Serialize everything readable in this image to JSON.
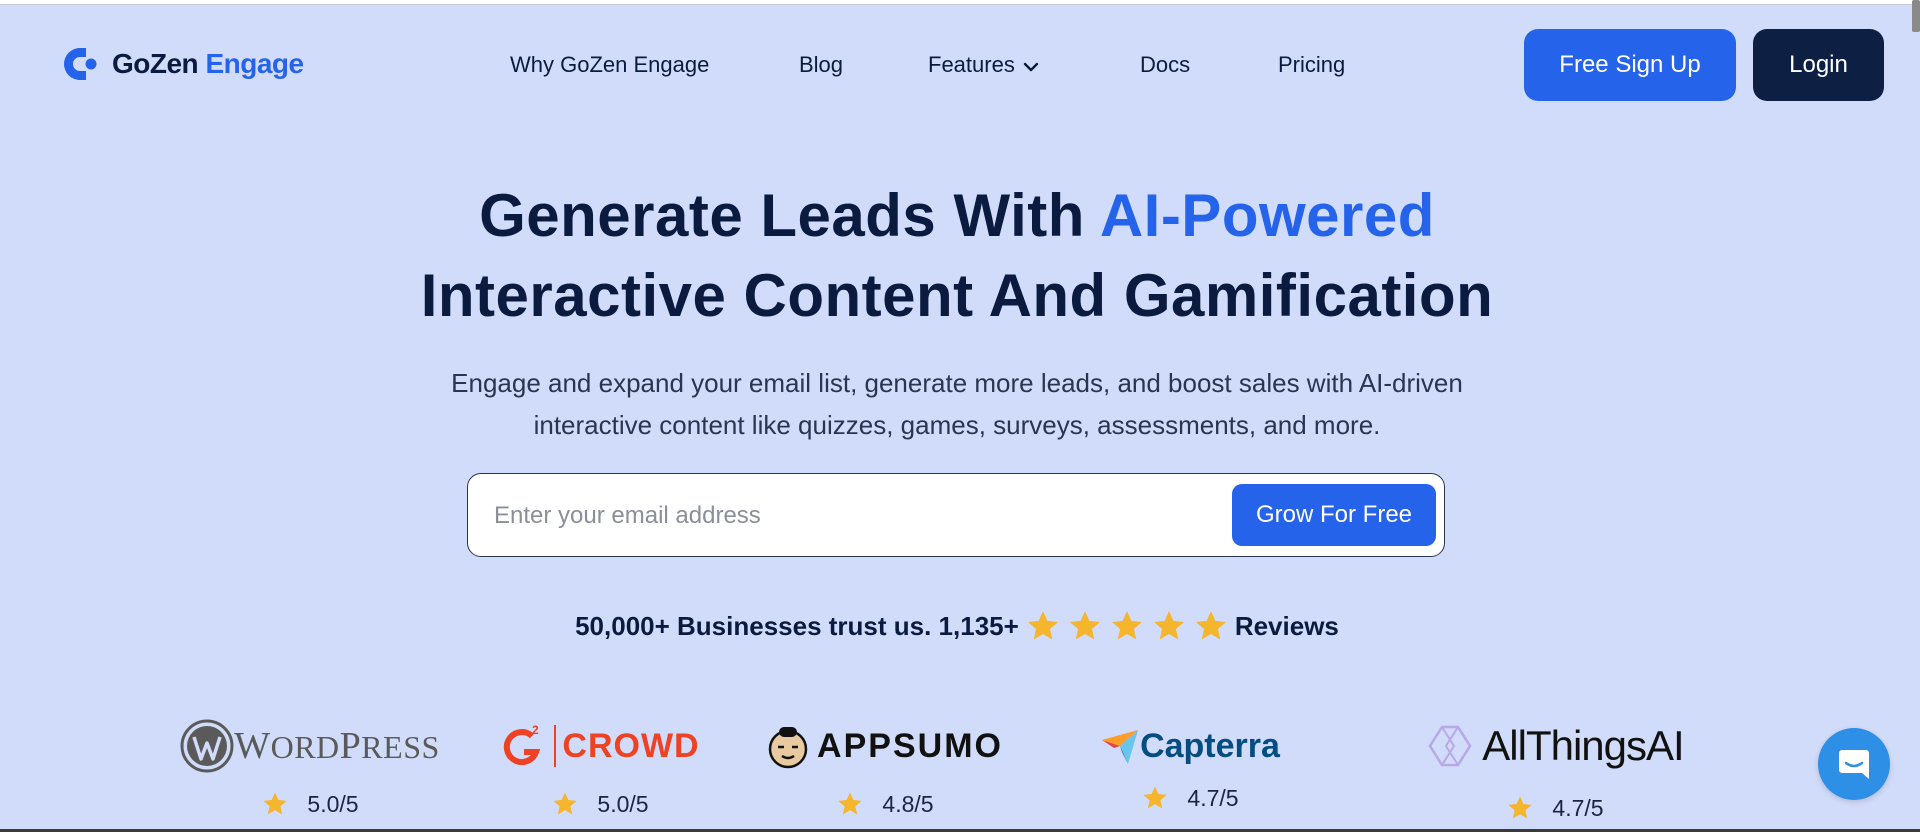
{
  "brand": {
    "name_part1": "GoZen",
    "name_part2": "Engage"
  },
  "nav": {
    "items": [
      {
        "label": "Why GoZen Engage"
      },
      {
        "label": "Blog"
      },
      {
        "label": "Features"
      },
      {
        "label": "Docs"
      },
      {
        "label": "Pricing"
      }
    ]
  },
  "header": {
    "signup_label": "Free Sign Up",
    "login_label": "Login"
  },
  "hero": {
    "title_line1_plain": "Generate Leads With ",
    "title_line1_accent": "AI-Powered",
    "title_line2": "Interactive Content And Gamification",
    "subtitle_line1": "Engage and expand your email list, generate more leads, and boost sales with AI-driven",
    "subtitle_line2": "interactive content like quizzes, games, surveys, assessments, and more."
  },
  "signup_form": {
    "email_placeholder": "Enter your email address",
    "email_value": "",
    "submit_label": "Grow For Free"
  },
  "trust": {
    "text_before": "50,000+ Businesses trust us. 1,135+",
    "star_count": 5,
    "text_after": "Reviews"
  },
  "reviews": [
    {
      "platform": "WordPress",
      "logo_text_a": "W",
      "logo_text_b": "ORD",
      "logo_text_c": "P",
      "logo_text_d": "RESS",
      "rating": "5.0/5"
    },
    {
      "platform": "G2 Crowd",
      "logo_text": "CROWD",
      "rating": "5.0/5"
    },
    {
      "platform": "AppSumo",
      "logo_text": "APPSUMO",
      "rating": "4.8/5"
    },
    {
      "platform": "Capterra",
      "logo_text": "Capterra",
      "rating": "4.7/5"
    },
    {
      "platform": "AllThingsAI",
      "logo_text": "AllThingsAI",
      "rating": "4.7/5"
    }
  ],
  "colors": {
    "background": "#d1dcfa",
    "primary": "#2563eb",
    "dark": "#0e1f44",
    "star": "#f5b52c",
    "chat": "#2e8fe6"
  },
  "icons": {
    "logo": "gozen-logo-icon",
    "nav_features": "chevron-down-icon",
    "star": "star-icon",
    "chat": "chat-bubble-icon"
  }
}
